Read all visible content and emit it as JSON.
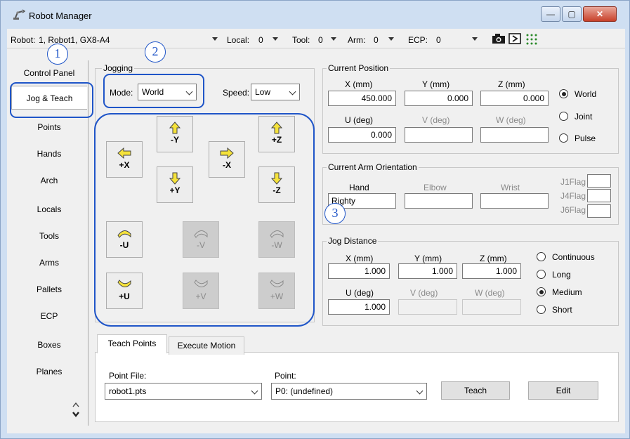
{
  "window": {
    "title": "Robot Manager",
    "controls": {
      "minimize": "—",
      "maximize": "▢",
      "close": "✕"
    }
  },
  "toolbar": {
    "robot_label": "Robot:",
    "robot_value": "1, Robot1, GX8-A4",
    "local_label": "Local:",
    "local_value": "0",
    "tool_label": "Tool:",
    "tool_value": "0",
    "arm_label": "Arm:",
    "arm_value": "0",
    "ecp_label": "ECP:",
    "ecp_value": "0",
    "icons": [
      "camera-icon",
      "run-window-icon",
      "io-monitor-icon"
    ]
  },
  "nav": {
    "items": [
      "Control Panel",
      "Jog & Teach",
      "Points",
      "Hands",
      "Arch",
      "Locals",
      "Tools",
      "Arms",
      "Pallets",
      "ECP",
      "Boxes",
      "Planes"
    ],
    "selected": "Jog & Teach"
  },
  "jogging": {
    "title": "Jogging",
    "mode_label": "Mode:",
    "mode_value": "World",
    "speed_label": "Speed:",
    "speed_value": "Low",
    "buttons": {
      "plus_x": "+X",
      "minus_x": "-X",
      "minus_y": "-Y",
      "plus_y": "+Y",
      "plus_z": "+Z",
      "minus_z": "-Z",
      "minus_u": "-U",
      "minus_v": "-V",
      "minus_w": "-W",
      "plus_u": "+U",
      "plus_v": "+V",
      "plus_w": "+W"
    }
  },
  "current_position": {
    "title": "Current Position",
    "x_label": "X (mm)",
    "x_value": "450.000",
    "y_label": "Y (mm)",
    "y_value": "0.000",
    "z_label": "Z (mm)",
    "z_value": "0.000",
    "u_label": "U (deg)",
    "u_value": "0.000",
    "v_label": "V (deg)",
    "v_value": "",
    "w_label": "W (deg)",
    "w_value": "",
    "modes": [
      "World",
      "Joint",
      "Pulse"
    ],
    "mode_selected": "World"
  },
  "arm_orientation": {
    "title": "Current Arm Orientation",
    "hand_label": "Hand",
    "hand_value": "Righty",
    "elbow_label": "Elbow",
    "elbow_value": "",
    "wrist_label": "Wrist",
    "wrist_value": "",
    "j1flag_label": "J1Flag",
    "j4flag_label": "J4Flag",
    "j6flag_label": "J6Flag"
  },
  "jog_distance": {
    "title": "Jog Distance",
    "x_label": "X (mm)",
    "x_value": "1.000",
    "y_label": "Y (mm)",
    "y_value": "1.000",
    "z_label": "Z (mm)",
    "z_value": "1.000",
    "u_label": "U (deg)",
    "u_value": "1.000",
    "v_label": "V (deg)",
    "w_label": "W (deg)",
    "modes": [
      "Continuous",
      "Long",
      "Medium",
      "Short"
    ],
    "mode_selected": "Medium"
  },
  "tabs": {
    "items": [
      "Teach Points",
      "Execute Motion"
    ],
    "selected": "Teach Points"
  },
  "teach_points": {
    "point_file_label": "Point File:",
    "point_file_value": "robot1.pts",
    "point_label": "Point:",
    "point_value": "P0: (undefined)",
    "teach_button": "Teach",
    "edit_button": "Edit"
  },
  "callouts": [
    "1",
    "2",
    "3"
  ],
  "colors": {
    "accent": "#1f55c8",
    "arrow_yellow": "#f5e23a",
    "titlebar": "#cfdff2"
  }
}
